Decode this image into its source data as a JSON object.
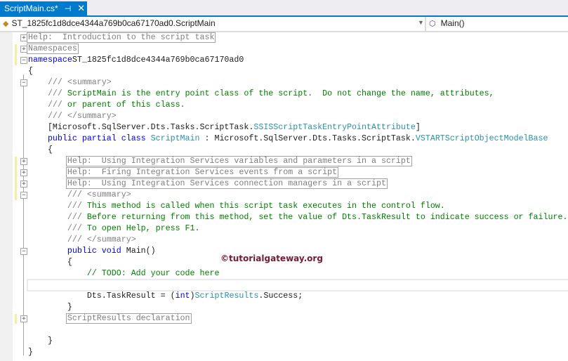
{
  "tab": {
    "title": "ScriptMain.cs*",
    "pin_icon": "pin-icon",
    "close_icon": "close-icon"
  },
  "nav": {
    "class_path": "ST_1825fc1d8dce4344a769b0ca67170ad0.ScriptMain",
    "member": "Main()"
  },
  "watermark": "©tutorialgateway.org",
  "colors": {
    "accent": "#007acc",
    "keyword": "#0000ff",
    "comment": "#008000",
    "type": "#2b91af"
  },
  "lines": [
    [
      [
        "box",
        "Help:  Introduction to the script task"
      ]
    ],
    [
      [
        "box",
        "Namespaces"
      ]
    ],
    [
      [
        "kw",
        "namespace"
      ],
      [
        "",
        "ST_1825fc1d8dce4344a769b0ca67170ad0"
      ]
    ],
    [
      [
        "",
        "{"
      ]
    ],
    [
      [
        "doc",
        "    /// <summary>"
      ]
    ],
    [
      [
        "doc",
        "    /// "
      ],
      [
        "cm",
        "ScriptMain is the entry point class of the script.  Do not change the name, attributes,"
      ]
    ],
    [
      [
        "doc",
        "    /// "
      ],
      [
        "cm",
        "or parent of this class."
      ]
    ],
    [
      [
        "doc",
        "    /// </summary>"
      ]
    ],
    [
      [
        "",
        "    [Microsoft.SqlServer.Dts.Tasks.ScriptTask."
      ],
      [
        "ty",
        "SSISScriptTaskEntryPointAttribute"
      ],
      [
        "",
        "]"
      ]
    ],
    [
      [
        "kw",
        "    public partial class "
      ],
      [
        "ty",
        "ScriptMain"
      ],
      [
        "",
        " : Microsoft.SqlServer.Dts.Tasks.ScriptTask."
      ],
      [
        "ty",
        "VSTARTScriptObjectModelBase"
      ]
    ],
    [
      [
        "",
        "    {"
      ]
    ],
    [
      [
        "",
        "        "
      ],
      [
        "box",
        "Help:  Using Integration Services variables and parameters in a script"
      ]
    ],
    [
      [
        "",
        "        "
      ],
      [
        "box",
        "Help:  Firing Integration Services events from a script"
      ]
    ],
    [
      [
        "",
        "        "
      ],
      [
        "box",
        "Help:  Using Integration Services connection managers in a script"
      ]
    ],
    [
      [
        "doc",
        "        /// <summary>"
      ]
    ],
    [
      [
        "doc",
        "        /// "
      ],
      [
        "cm",
        "This method is called when this script task executes in the control flow."
      ]
    ],
    [
      [
        "doc",
        "        /// "
      ],
      [
        "cm",
        "Before returning from this method, set the value of Dts.TaskResult to indicate success or failure."
      ]
    ],
    [
      [
        "doc",
        "        /// "
      ],
      [
        "cm",
        "To open Help, press F1."
      ]
    ],
    [
      [
        "doc",
        "        /// </summary>"
      ]
    ],
    [
      [
        "kw",
        "        public void "
      ],
      [
        "",
        "Main()"
      ]
    ],
    [
      [
        "",
        "        {"
      ]
    ],
    [
      [
        "cm",
        "            // TODO: Add your code here"
      ]
    ],
    [
      [
        "",
        ""
      ]
    ],
    [
      [
        "",
        "            Dts.TaskResult = ("
      ],
      [
        "kw",
        "int"
      ],
      [
        "",
        ")"
      ],
      [
        "ty",
        "ScriptResults"
      ],
      [
        "",
        ".Success;"
      ]
    ],
    [
      [
        "",
        "        }"
      ]
    ],
    [
      [
        "",
        "        "
      ],
      [
        "box",
        "ScriptResults declaration"
      ]
    ],
    [
      [
        "",
        ""
      ]
    ],
    [
      [
        "",
        "    }"
      ]
    ],
    [
      [
        "",
        "}"
      ]
    ]
  ]
}
